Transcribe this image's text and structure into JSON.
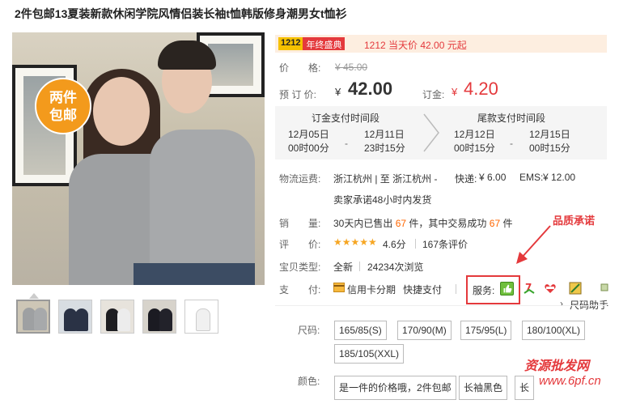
{
  "product": {
    "title": "2件包邮13夏装新款休闲学院风情侣装长袖t恤韩版修身潮男女t恤衫",
    "badge_line1": "两件",
    "badge_line2": "包邮"
  },
  "promo": {
    "tag_year": "1212",
    "tag_text": "年终盛典",
    "text": "1212 当天价 42.00 元起"
  },
  "price": {
    "label": "价　　格:",
    "original": "¥ 45.00",
    "presale_label": "预 订 价:",
    "yen": "¥",
    "presale_value": "42.00",
    "deposit_label": "订金:",
    "deposit_yen": "¥",
    "deposit_value": "4.20"
  },
  "schedule": {
    "deposit_title": "订金支付时间段",
    "deposit_start": [
      "12月05日",
      "00时00分"
    ],
    "deposit_end": [
      "12月11日",
      "23时15分"
    ],
    "final_title": "尾款支付时间段",
    "final_start": [
      "12月12日",
      "00时15分"
    ],
    "final_end": [
      "12月15日",
      "00时15分"
    ],
    "dash": "-"
  },
  "shipping": {
    "label": "物流运费:",
    "route": "浙江杭州 | 至  浙江杭州 -",
    "express": "快递:",
    "express_price": "¥ 6.00",
    "ems": "EMS:",
    "ems_price": "¥ 12.00",
    "promise": "卖家承诺48小时内发货"
  },
  "sales": {
    "label": "销　　量:",
    "prefix": "30天内已售出",
    "count": "67",
    "mid": "件，其中交易成功",
    "success": "67",
    "suffix": "件"
  },
  "rating": {
    "label": "评　　价:",
    "stars": "★★★★★",
    "score": "4.6分",
    "reviews": "167条评价"
  },
  "category": {
    "label": "宝贝类型:",
    "type": "全新",
    "views": "24234次浏览"
  },
  "payment": {
    "label": "支　　付:",
    "credit": "信用卡分期",
    "quick": "快捷支付",
    "service_label": "服务:",
    "size_helper": "尺码助手"
  },
  "annotation": {
    "quality": "品质承诺"
  },
  "sizes": {
    "label": "尺码:",
    "options": [
      "165/85(S)",
      "170/90(M)",
      "175/95(L)",
      "180/100(XL)",
      "185/105(XXL)"
    ]
  },
  "colors": {
    "label": "颜色:",
    "options": [
      "是一件的价格哦，2件包邮",
      "长袖黑色",
      "长"
    ]
  },
  "watermark": {
    "line1": "资源批发网",
    "line2": "www.6pf.cn"
  },
  "palette": {
    "accent_red": "#e4393c",
    "promo_bg": "#fdeee0",
    "star": "#f6a623"
  }
}
